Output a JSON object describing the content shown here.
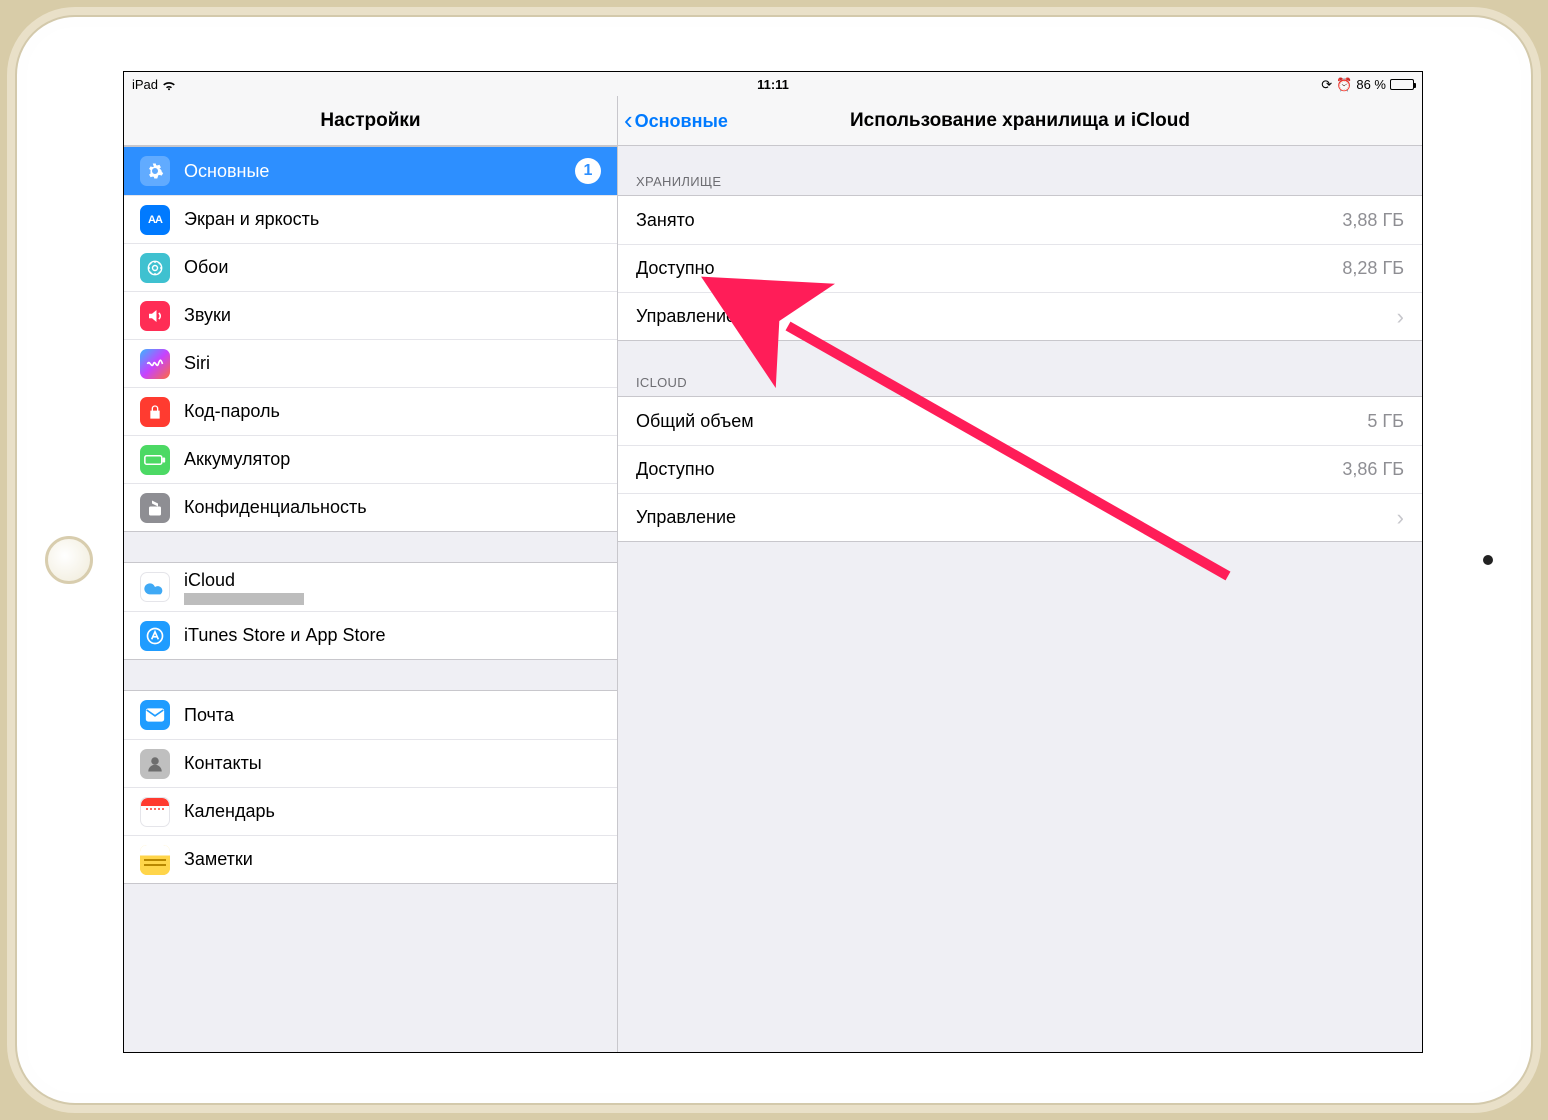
{
  "statusbar": {
    "device": "iPad",
    "time": "11:11",
    "battery_text": "86 %",
    "battery_level": 86
  },
  "sidebar": {
    "title": "Настройки",
    "selected_badge": "1",
    "groups": [
      {
        "items": [
          {
            "id": "general",
            "label": "Основные",
            "icon": "gear",
            "selected": true,
            "badge": "1"
          },
          {
            "id": "display",
            "label": "Экран и яркость",
            "icon": "display"
          },
          {
            "id": "wallpaper",
            "label": "Обои",
            "icon": "wall"
          },
          {
            "id": "sounds",
            "label": "Звуки",
            "icon": "sound"
          },
          {
            "id": "siri",
            "label": "Siri",
            "icon": "siri"
          },
          {
            "id": "passcode",
            "label": "Код-пароль",
            "icon": "pass"
          },
          {
            "id": "battery",
            "label": "Аккумулятор",
            "icon": "batt"
          },
          {
            "id": "privacy",
            "label": "Конфиденциальность",
            "icon": "priv"
          }
        ]
      },
      {
        "items": [
          {
            "id": "icloud",
            "label": "iCloud",
            "icon": "cloud",
            "sub_redacted": true
          },
          {
            "id": "store",
            "label": "iTunes Store и App Store",
            "icon": "store"
          }
        ]
      },
      {
        "items": [
          {
            "id": "mail",
            "label": "Почта",
            "icon": "mail"
          },
          {
            "id": "contacts",
            "label": "Контакты",
            "icon": "contacts"
          },
          {
            "id": "calendar",
            "label": "Календарь",
            "icon": "cal"
          },
          {
            "id": "notes",
            "label": "Заметки",
            "icon": "notes"
          }
        ]
      }
    ]
  },
  "detail": {
    "back_label": "Основные",
    "title": "Использование хранилища и iCloud",
    "sections": [
      {
        "header": "ХРАНИЛИЩЕ",
        "rows": [
          {
            "label": "Занято",
            "value": "3,88 ГБ"
          },
          {
            "label": "Доступно",
            "value": "8,28 ГБ"
          },
          {
            "label": "Управление",
            "chevron": true,
            "interactable": true,
            "highlight": true
          }
        ]
      },
      {
        "header": "ICLOUD",
        "rows": [
          {
            "label": "Общий объем",
            "value": "5 ГБ"
          },
          {
            "label": "Доступно",
            "value": "3,86 ГБ"
          },
          {
            "label": "Управление",
            "chevron": true,
            "interactable": true
          }
        ]
      }
    ]
  }
}
